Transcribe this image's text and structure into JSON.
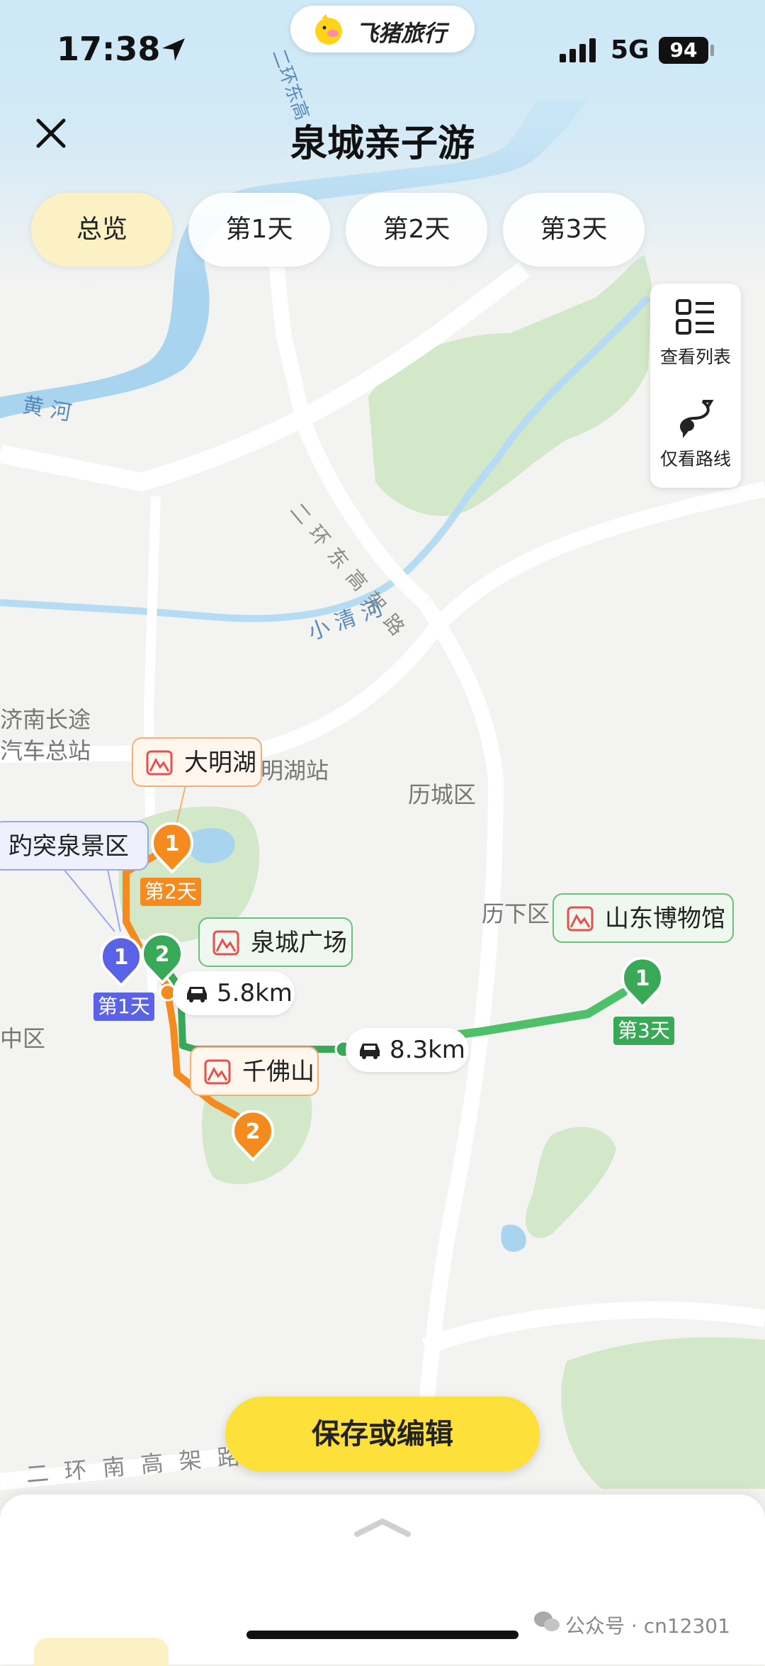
{
  "status_bar": {
    "time": "17:38",
    "network": "5G",
    "battery": "94"
  },
  "brand": {
    "name": "飞猪旅行"
  },
  "header": {
    "title": "泉城亲子游"
  },
  "tabs": [
    {
      "label": "总览",
      "active": true
    },
    {
      "label": "第1天",
      "active": false
    },
    {
      "label": "第2天",
      "active": false
    },
    {
      "label": "第3天",
      "active": false
    }
  ],
  "side_panel": {
    "list_label": "查看列表",
    "route_label": "仅看路线"
  },
  "map_labels": {
    "river_yellow_1": "黄 河",
    "river_yellow_2": "黄河",
    "east_ring": "二 环 东 高 架 路",
    "xiaoqing": "小 清 河",
    "bus_station_1": "济南长途",
    "bus_station_2": "汽车总站",
    "daming_station": "明湖站",
    "licheng": "历城区",
    "lixia": "历下区",
    "shizhong": "中区",
    "south_ring": "二 环 南 高 架 路",
    "east_ring_top": "二环东高"
  },
  "pois": {
    "daminghu": "大明湖",
    "baotuquan": "趵突泉景区",
    "quancheng": "泉城广场",
    "qianfoshan": "千佛山",
    "museum": "山东博物馆"
  },
  "pins": {
    "day1": {
      "num": "1",
      "tag": "第1天",
      "color": "#5a62e8"
    },
    "day2_a": {
      "num": "1",
      "tag": "第2天",
      "color": "#f58a1f"
    },
    "day2_b": {
      "num": "2",
      "color": "#f58a1f"
    },
    "day1_b": {
      "num": "2",
      "color": "#3aa957"
    },
    "day3": {
      "num": "1",
      "tag": "第3天",
      "color": "#3aa957"
    }
  },
  "distances": {
    "d1": "5.8km",
    "d2": "8.3km"
  },
  "actions": {
    "save": "保存或编辑"
  },
  "watermark": "公众号 · cn12301"
}
